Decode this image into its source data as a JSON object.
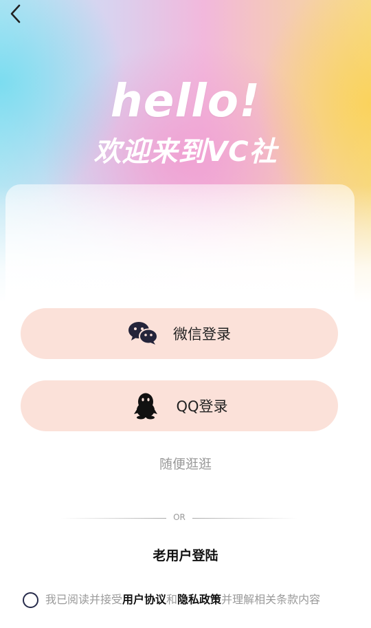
{
  "header": {
    "back_icon": "chevron-left-icon",
    "hello": "hello!",
    "welcome": "欢迎来到VC社"
  },
  "login": {
    "wechat_label": "微信登录",
    "wechat_icon": "wechat-icon",
    "qq_label": "QQ登录",
    "qq_icon": "qq-penguin-icon",
    "browse_label": "随便逛逛"
  },
  "divider": {
    "text": "OR"
  },
  "old_user": {
    "label": "老用户登陆"
  },
  "agreement": {
    "prefix": "我已阅读并接受",
    "user_agreement": "用户协议",
    "and": "和",
    "privacy_policy": "隐私政策",
    "suffix": "并理解相关条款内容",
    "checked": false
  },
  "colors": {
    "button_bg": "#fbe1d9",
    "text_dark": "#111111",
    "text_muted": "#999999"
  }
}
